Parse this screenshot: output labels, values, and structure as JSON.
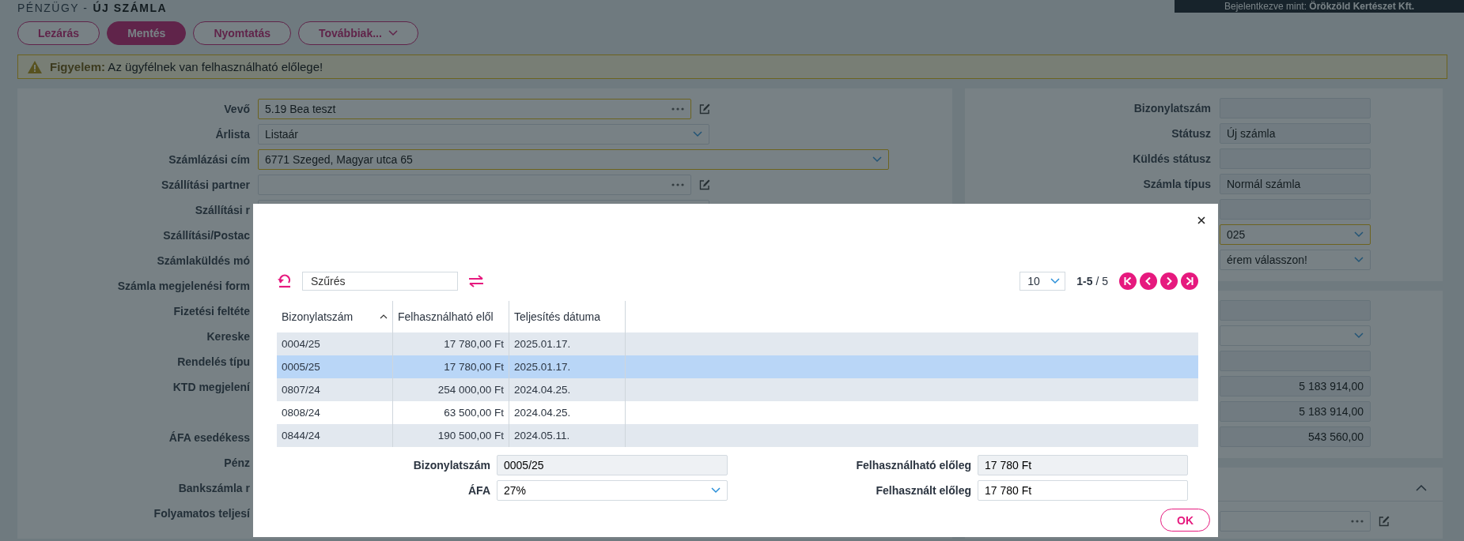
{
  "header": {
    "breadcrumb": "PÉNZÜGY -",
    "title": "ÚJ SZÁMLA",
    "user": "Bejelentkezve mint: **Örökzöld Kertészet Kft.**"
  },
  "actions": [
    {
      "label": "Lezárás",
      "kind": "outline"
    },
    {
      "label": "Mentés",
      "kind": "primary"
    },
    {
      "label": "Nyomtatás",
      "kind": "outline"
    },
    {
      "label": "Továbbiak...",
      "kind": "dropdown"
    }
  ],
  "alert": {
    "message": "**Figyelem:** Az ügyfélnek van felhasználható előlege!"
  },
  "left_form": [
    {
      "label": "Vevő",
      "kind": "lookup",
      "value": "5.19 Bea teszt",
      "required": true
    },
    {
      "label": "Árlista",
      "kind": "select",
      "value": "Listaár",
      "required": false
    },
    {
      "label": "Számlázási cím",
      "kind": "wide_select",
      "value": "6771 Szeged, Magyar utca 65",
      "required": true
    },
    {
      "label": "Szállítási partner",
      "kind": "lookup",
      "required": false
    },
    {
      "label": "Szállítási r",
      "kind": "text"
    },
    {
      "label": "Szállítási/Postac",
      "kind": "text"
    },
    {
      "label": "Számlaküldés mó",
      "kind": "text"
    },
    {
      "label": "Számla megjelenési form",
      "kind": "text"
    },
    {
      "label": "Fizetési feltéte",
      "kind": "text"
    },
    {
      "label": "Kereske",
      "kind": "text"
    },
    {
      "label": "Rendelés típu",
      "kind": "text"
    },
    {
      "label": "KTD megjelení",
      "kind": "textarea"
    },
    {
      "label": "ÁFA esedékess",
      "kind": "text"
    },
    {
      "label": "Pénz",
      "kind": "text"
    },
    {
      "label": "Bankszámla r",
      "kind": "text"
    },
    {
      "label": "Folyamatos teljesí",
      "kind": "text"
    }
  ],
  "right_panel": {
    "sections": [
      {
        "rows": [
          {
            "label": "Bizonylatszám",
            "kind": "readonly"
          },
          {
            "label": "Státusz",
            "kind": "readonly",
            "value": "Új számla"
          },
          {
            "label": "Küldés státusz",
            "kind": "readonly"
          },
          {
            "label": "Számla típus",
            "kind": "readonly",
            "value": "Normál számla"
          },
          {
            "kind": "readonly"
          },
          {
            "kind": "select",
            "value": "025",
            "required": true
          },
          {
            "kind": "select",
            "value": "érem válasszon!",
            "required": false
          }
        ]
      },
      {
        "rows": [
          {
            "kind": "readonly"
          },
          {
            "kind": "select",
            "required": false
          },
          {
            "kind": "readonly"
          },
          {
            "kind": "number",
            "value": "5 183 914,00"
          },
          {
            "kind": "number",
            "value": "5 183 914,00"
          },
          {
            "kind": "number",
            "value": "543 560,00"
          }
        ]
      },
      {
        "expanded": true,
        "rows": [
          {
            "kind": "lookup"
          }
        ]
      }
    ]
  },
  "dialog": {
    "filter": {
      "placeholder": "Szűrés"
    },
    "page_size": "10",
    "range": "**1-5** / 5",
    "columns": [
      {
        "label": "Bizonylatszám",
        "kind": "text",
        "sorted": true
      },
      {
        "label": "Felhasználható elől",
        "kind": "amount",
        "sorted": false
      },
      {
        "label": "Teljesítés dátuma",
        "kind": "text",
        "sorted": false
      }
    ],
    "rows": [
      {
        "cells": [
          "0004/25",
          "17 780,00 Ft",
          "2025.01.17."
        ],
        "selected": false
      },
      {
        "cells": [
          "0005/25",
          "17 780,00 Ft",
          "2025.01.17."
        ],
        "selected": true
      },
      {
        "cells": [
          "0807/24",
          "254 000,00 Ft",
          "2024.04.25."
        ],
        "selected": false
      },
      {
        "cells": [
          "0808/24",
          "63 500,00 Ft",
          "2024.04.25."
        ],
        "selected": false
      },
      {
        "cells": [
          "0844/24",
          "190 500,00 Ft",
          "2024.05.11."
        ],
        "selected": false
      }
    ],
    "fields": [
      {
        "label": "Bizonylatszám",
        "kind": "readonly",
        "value": "0005/25"
      },
      {
        "label": "Felhasználható előleg",
        "kind": "readonly",
        "value": "17 780 Ft"
      },
      {
        "label": "ÁFA",
        "kind": "select",
        "value": "27%"
      },
      {
        "label": "Felhasznált előleg",
        "kind": "text",
        "value": "17 780 Ft"
      }
    ],
    "ok": "OK"
  }
}
